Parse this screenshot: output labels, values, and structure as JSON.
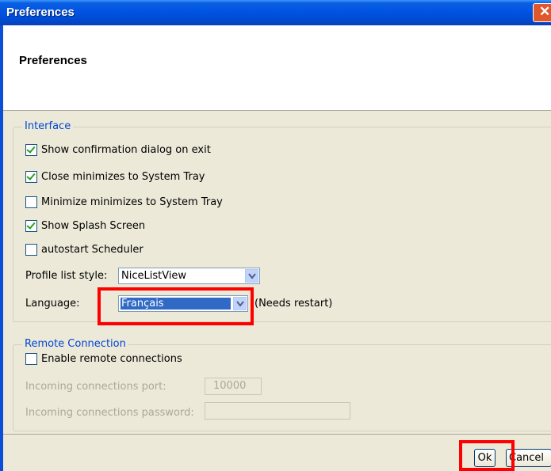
{
  "window": {
    "title": "Preferences",
    "close_glyph": "✕"
  },
  "header": {
    "title": "Preferences"
  },
  "interface": {
    "legend": "Interface",
    "checkboxes": [
      {
        "label": "Show confirmation dialog on exit",
        "checked": true
      },
      {
        "label": "Close minimizes to System Tray",
        "checked": true
      },
      {
        "label": "Minimize minimizes to System Tray",
        "checked": false
      },
      {
        "label": "Show Splash Screen",
        "checked": true
      },
      {
        "label": "autostart Scheduler",
        "checked": false
      }
    ],
    "profile_list_style": {
      "label": "Profile list style:",
      "value": "NiceListView"
    },
    "language": {
      "label": "Language:",
      "value": "Français",
      "note": "(Needs restart)"
    }
  },
  "remote": {
    "legend": "Remote Connection",
    "enable_label": "Enable remote connections",
    "enable_checked": false,
    "port": {
      "label": "Incoming connections port:",
      "value": "10000"
    },
    "password": {
      "label": "Incoming connections password:",
      "value": ""
    }
  },
  "buttons": {
    "ok": "Ok",
    "cancel": "Cancel"
  },
  "colors": {
    "highlight": "#ff0000",
    "accent": "#0046d5",
    "selection": "#316ac5"
  }
}
